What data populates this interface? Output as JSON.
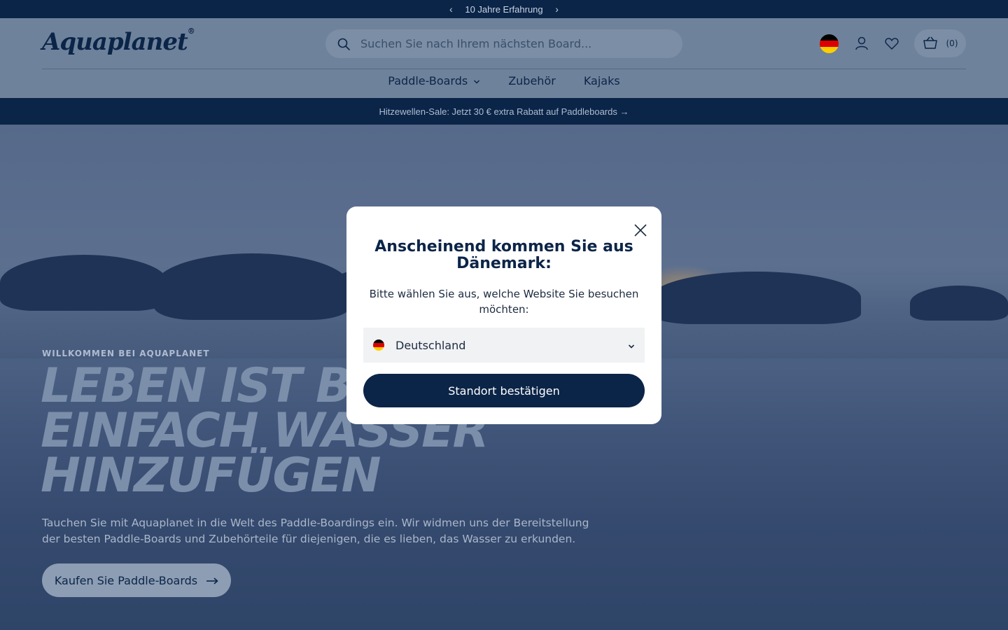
{
  "topbar": {
    "message": "10 Jahre Erfahrung",
    "prev_icon": "chevron-left-icon",
    "next_icon": "chevron-right-icon"
  },
  "header": {
    "logo_text": "Aquaplanet",
    "logo_mark": "®",
    "search_placeholder": "Suchen Sie nach Ihrem nächsten Board...",
    "cart_count": "(0)",
    "flag_colors": [
      "#000000",
      "#dd0000",
      "#ffce00"
    ]
  },
  "nav": {
    "items": [
      {
        "label": "Paddle-Boards",
        "has_dropdown": true
      },
      {
        "label": "Zubehör",
        "has_dropdown": false
      },
      {
        "label": "Kajaks",
        "has_dropdown": false
      }
    ]
  },
  "sale_bar": {
    "text": "Hitzewellen-Sale: Jetzt 30 € extra Rabatt auf Paddleboards →"
  },
  "hero": {
    "eyebrow": "WILLKOMMEN BEI AQUAPLANET",
    "headline_line1": "LEBEN IST B",
    "headline_line2": "EINFACH WASSER",
    "headline_line3": "HINZUFÜGEN",
    "description": "Tauchen Sie mit Aquaplanet in die Welt des Paddle-Boardings ein. Wir widmen uns der Bereitstellung der besten Paddle-Boards und Zubehörteile für diejenigen, die es lieben, das Wasser zu erkunden.",
    "cta_label": "Kaufen Sie Paddle-Boards"
  },
  "modal": {
    "title": "Anscheinend kommen Sie aus Dänemark:",
    "subtitle": "Bitte wählen Sie aus, welche Website Sie besuchen möchten:",
    "selected_country": "Deutschland",
    "confirm_label": "Standort bestätigen"
  },
  "colors": {
    "navy": "#0b2548",
    "header_bg": "#6f829b",
    "modal_bg": "#ffffff",
    "select_bg": "#f1f2f4"
  }
}
